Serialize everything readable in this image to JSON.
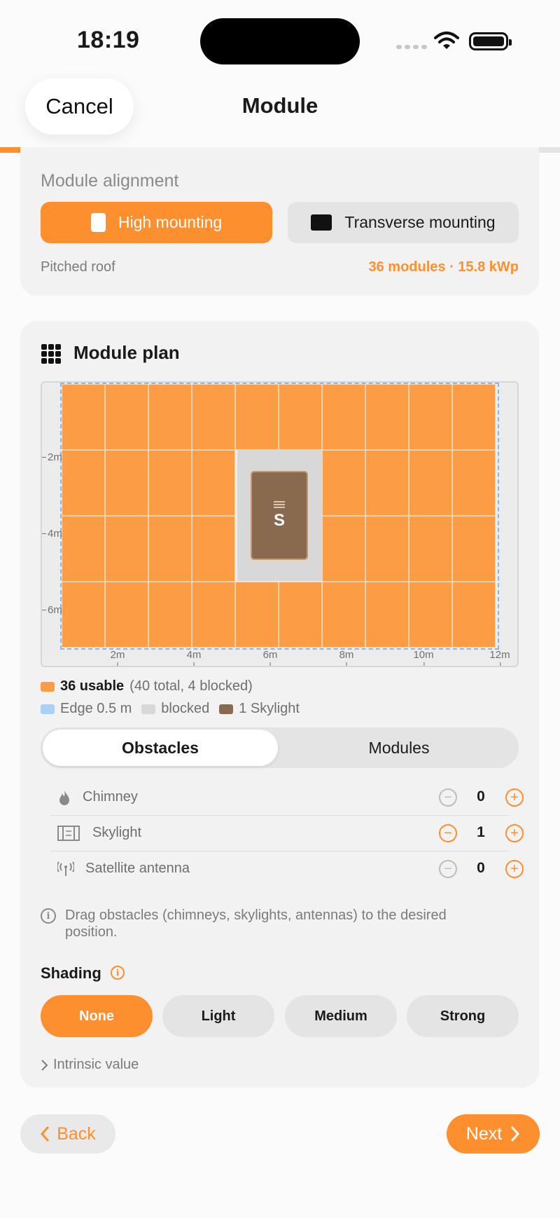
{
  "status_bar": {
    "time": "18:19"
  },
  "nav": {
    "cancel_label": "Cancel",
    "title": "Module"
  },
  "progress": {
    "fraction": 0.775
  },
  "alignment": {
    "label": "Module alignment",
    "options": [
      {
        "label": "High mounting",
        "selected": true
      },
      {
        "label": "Transverse mounting",
        "selected": false
      }
    ],
    "roof_type": "Pitched roof",
    "summary": "36 modules · 15.8 kWp"
  },
  "module_plan": {
    "title": "Module plan",
    "y_ticks": [
      "2m",
      "4m",
      "6m"
    ],
    "x_ticks": [
      "2m",
      "4m",
      "6m",
      "8m",
      "10m",
      "12m"
    ],
    "skylight_label": "S",
    "legend": {
      "usable": "36 usable",
      "usable_detail": "(40 total, 4 blocked)",
      "edge": "Edge 0.5 m",
      "blocked": "blocked",
      "skylight": "1 Skylight"
    },
    "colors": {
      "module": "#fc9d45",
      "edge": "#84b8ef",
      "blocked": "#d8d8d8",
      "skylight": "#8a6a4f"
    }
  },
  "tabs": [
    {
      "label": "Obstacles",
      "active": true
    },
    {
      "label": "Modules",
      "active": false
    }
  ],
  "obstacles": [
    {
      "icon": "flame-icon",
      "name": "Chimney",
      "count": "0"
    },
    {
      "icon": "skylight-icon",
      "name": "Skylight",
      "count": "1"
    },
    {
      "icon": "antenna-icon",
      "name": "Satellite antenna",
      "count": "0"
    }
  ],
  "hint": "Drag obstacles (chimneys, skylights, antennas) to the desired position.",
  "shading": {
    "label": "Shading",
    "options": [
      {
        "label": "None",
        "selected": true
      },
      {
        "label": "Light",
        "selected": false
      },
      {
        "label": "Medium",
        "selected": false
      },
      {
        "label": "Strong",
        "selected": false
      }
    ],
    "intrinsic_label": "Intrinsic value"
  },
  "footer": {
    "back_label": "Back",
    "next_label": "Next"
  },
  "accent_color": "#fd8f2f"
}
